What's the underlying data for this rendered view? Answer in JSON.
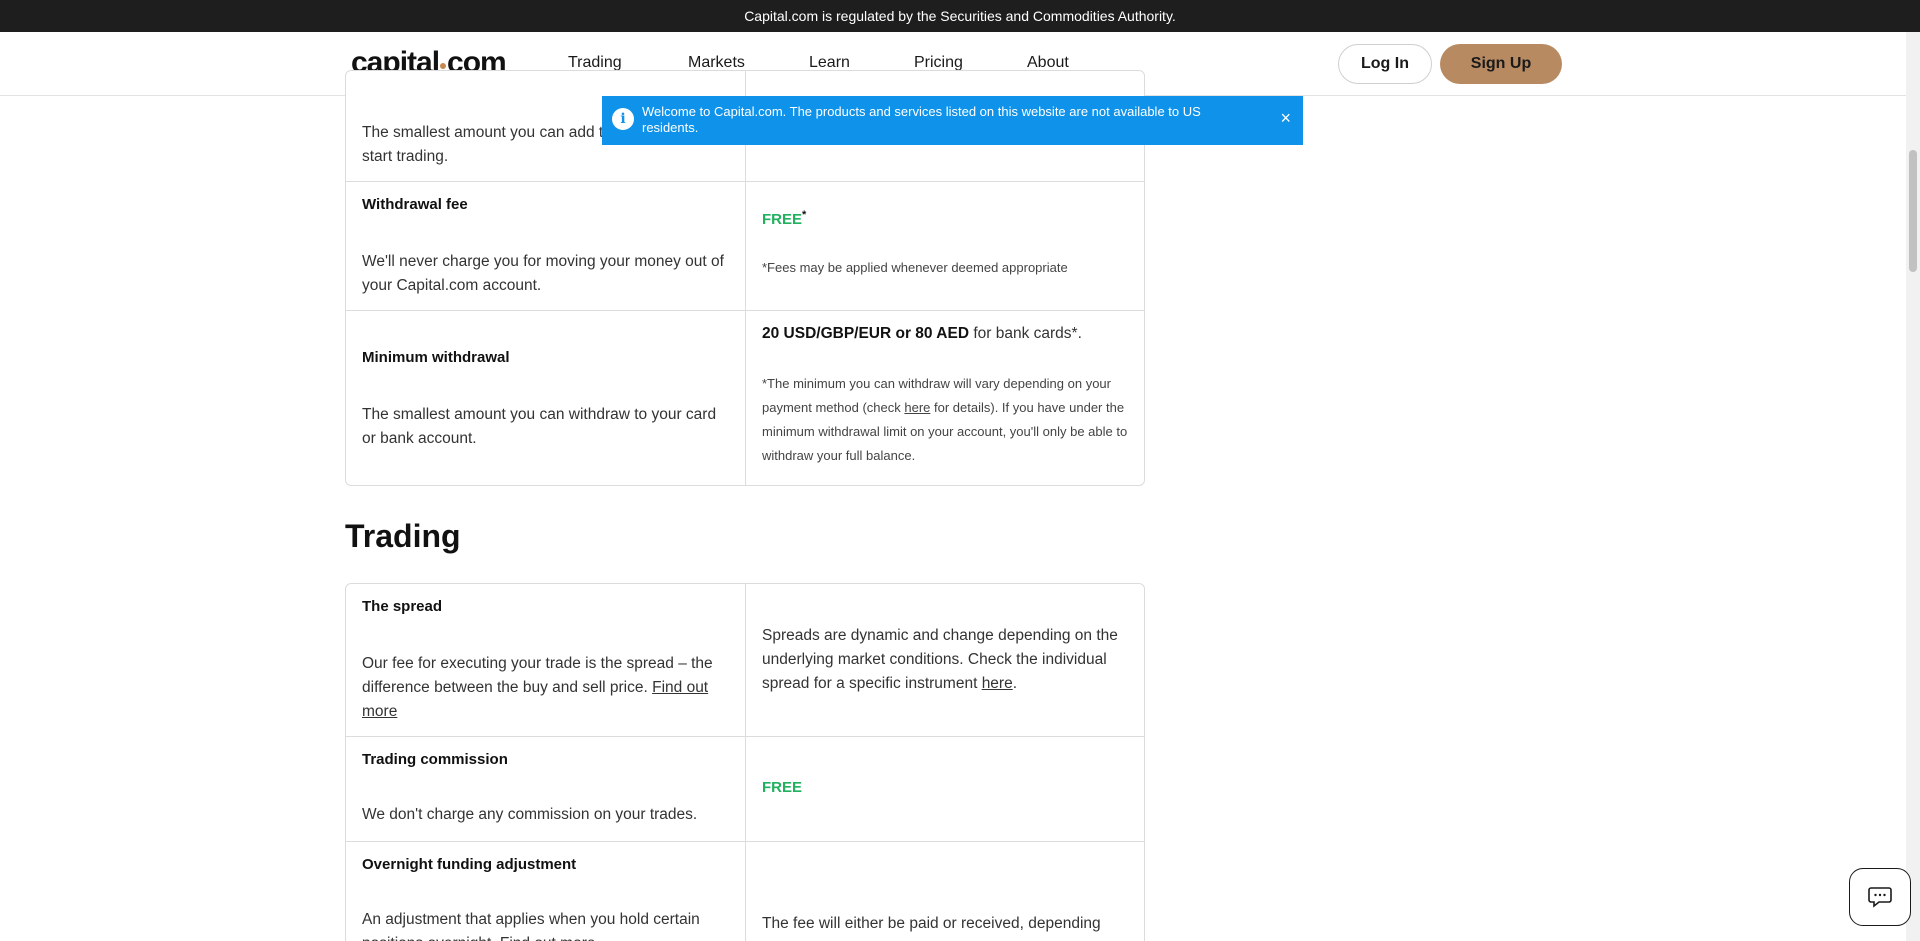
{
  "reg_bar": {
    "text": "Capital.com is regulated by the Securities and Commodities Authority."
  },
  "header": {
    "logo_left": "capital",
    "logo_right": "com",
    "nav": [
      "Trading",
      "Markets",
      "Learn",
      "Pricing",
      "About"
    ],
    "login": "Log In",
    "signup": "Sign Up"
  },
  "banner": {
    "message": "Welcome to Capital.com. The products and services listed on this website are not available to US residents.",
    "close": "×",
    "info_symbol": "i"
  },
  "funding_table": {
    "deposit_desc": "The smallest amount you can add to your account to start trading.",
    "withdrawal_fee": {
      "label": "Withdrawal fee",
      "desc": "We'll never charge you for moving your money out of your Capital.com account.",
      "value": "FREE",
      "mark": "*",
      "note": "*Fees may be applied whenever deemed appropriate"
    },
    "min_withdrawal": {
      "label": "Minimum withdrawal",
      "desc": "The smallest amount you can withdraw to your card or bank account.",
      "value_bold": "20 USD/GBP/EUR or 80 AED",
      "value_rest": " for bank cards*.",
      "note_a": "*The minimum you can withdraw will vary depending on your payment method (check ",
      "note_link": "here",
      "note_b": " for details). If you have under the minimum withdrawal limit on your account, you'll only be able to withdraw your full balance."
    }
  },
  "trading_section": {
    "title": "Trading",
    "spread": {
      "label": "The spread",
      "desc": "Our fee for executing your trade is the spread – the difference between the buy and sell price. ",
      "link": "Find out more",
      "value_a": "Spreads are dynamic and change depending on the underlying market conditions. Check the individual spread for a specific instrument ",
      "value_link": "here",
      "value_b": "."
    },
    "commission": {
      "label": "Trading commission",
      "desc": "We don't charge any commission on your trades.",
      "value": "FREE"
    },
    "overnight": {
      "label": "Overnight funding adjustment",
      "desc": "An adjustment that applies when you hold certain positions overnight. Find out more",
      "value": "The fee will either be paid or received, depending"
    }
  },
  "colors": {
    "accent": "#b88a62",
    "banner": "#0f93ea",
    "free": "#21b15f"
  }
}
